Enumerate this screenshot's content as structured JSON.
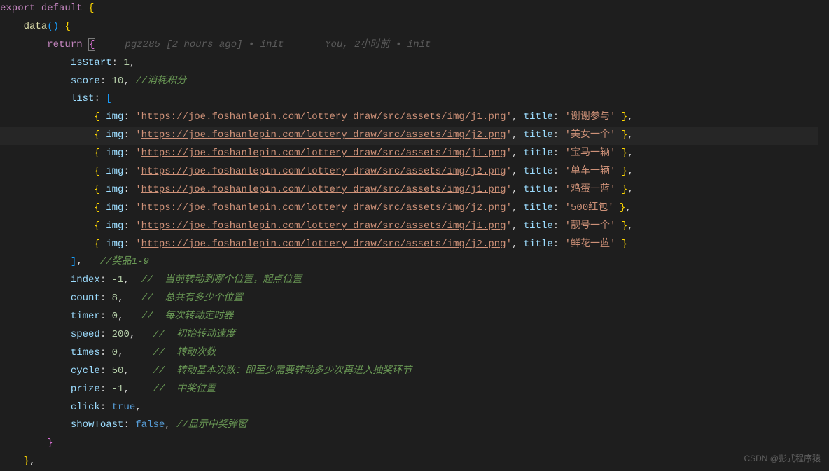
{
  "code": {
    "l1": {
      "export": "export",
      "default": "default",
      "brace": "{"
    },
    "l2": {
      "method": "data",
      "paren": "()",
      "brace": "{"
    },
    "l3": {
      "return": "return",
      "brace": "{"
    },
    "blame1": {
      "author": "pgz285",
      "time": "[2 hours ago]",
      "sep": "•",
      "msg": "init"
    },
    "blame2": {
      "author": "You,",
      "time": "2小时前",
      "sep": "•",
      "msg": "init"
    },
    "l4": {
      "prop": "isStart",
      "val": "1"
    },
    "l5": {
      "prop": "score",
      "val": "10",
      "comment": "//消耗积分"
    },
    "l6": {
      "prop": "list",
      "bracket": "["
    },
    "items": [
      {
        "img": "https://joe.foshanlepin.com/lottery_draw/src/assets/img/j1.png",
        "title": "谢谢参与"
      },
      {
        "img": "https://joe.foshanlepin.com/lottery_draw/src/assets/img/j2.png",
        "title": "美女一个"
      },
      {
        "img": "https://joe.foshanlepin.com/lottery_draw/src/assets/img/j1.png",
        "title": "宝马一辆"
      },
      {
        "img": "https://joe.foshanlepin.com/lottery_draw/src/assets/img/j2.png",
        "title": "单车一辆"
      },
      {
        "img": "https://joe.foshanlepin.com/lottery_draw/src/assets/img/j1.png",
        "title": "鸡蛋一蓝"
      },
      {
        "img": "https://joe.foshanlepin.com/lottery_draw/src/assets/img/j2.png",
        "title": "500红包"
      },
      {
        "img": "https://joe.foshanlepin.com/lottery_draw/src/assets/img/j1.png",
        "title": "靓号一个"
      },
      {
        "img": "https://joe.foshanlepin.com/lottery_draw/src/assets/img/j2.png",
        "title": "鲜花一蓝"
      }
    ],
    "item_labels": {
      "img": "img",
      "title": "title"
    },
    "l_end_list": {
      "bracket": "]",
      "comment": "//奖品1-9"
    },
    "l_index": {
      "prop": "index",
      "val": "-1",
      "comment": "//  当前转动到哪个位置，起点位置"
    },
    "l_count": {
      "prop": "count",
      "val": "8",
      "comment": "//  总共有多少个位置"
    },
    "l_timer": {
      "prop": "timer",
      "val": "0",
      "comment": "//  每次转动定时器"
    },
    "l_speed": {
      "prop": "speed",
      "val": "200",
      "comment": "//  初始转动速度"
    },
    "l_times": {
      "prop": "times",
      "val": "0",
      "comment": "//  转动次数"
    },
    "l_cycle": {
      "prop": "cycle",
      "val": "50",
      "comment": "//  转动基本次数：即至少需要转动多少次再进入抽奖环节"
    },
    "l_prize": {
      "prop": "prize",
      "val": "-1",
      "comment": "//  中奖位置"
    },
    "l_click": {
      "prop": "click",
      "val": "true"
    },
    "l_toast": {
      "prop": "showToast",
      "val": "false",
      "comment": "//显示中奖弹窗"
    }
  },
  "watermark": "CSDN @彭式程序猿"
}
